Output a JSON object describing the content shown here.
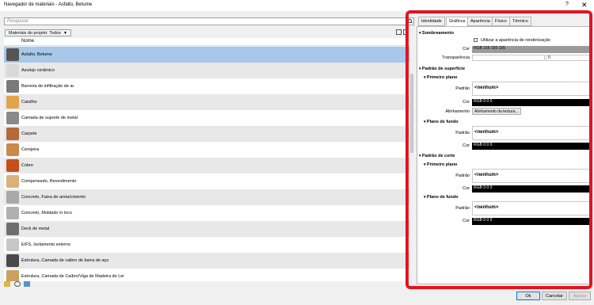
{
  "window": {
    "title": "Navegador de materiais - Asfalto, Betume",
    "help": "?",
    "close": "✕"
  },
  "search": {
    "placeholder": "Pesquisar"
  },
  "filter": {
    "label": "Materiais do projeto: Todos"
  },
  "list": {
    "column": "Nome",
    "items": [
      {
        "label": "Asfalto, Betume",
        "color": "#555555",
        "selected": true
      },
      {
        "label": "Azulejo cerâmico",
        "color": "#d9d9d9"
      },
      {
        "label": "Barreira de infiltração de ar",
        "color": "#7a7a7a"
      },
      {
        "label": "Caixilho",
        "color": "#e3a24c"
      },
      {
        "label": "Camada de suporte de metal",
        "color": "#8a8a8a"
      },
      {
        "label": "Carpete",
        "color": "#b46a3a"
      },
      {
        "label": "Cerejeira",
        "color": "#c98a4a"
      },
      {
        "label": "Cobre",
        "color": "#c4501a"
      },
      {
        "label": "Compensado, Revestimento",
        "color": "#d9b27a"
      },
      {
        "label": "Concreto, Faixa de areia/cimento",
        "color": "#a8a8a8"
      },
      {
        "label": "Concreto, Moldado in loco",
        "color": "#b0b0b0"
      },
      {
        "label": "Deck de metal",
        "color": "#6e6e6e"
      },
      {
        "label": "EIFS, Isolamento externo",
        "color": "#c7c7c7"
      },
      {
        "label": "Estrutura, Camada de caibro de barra de aço",
        "color": "#4a4a4a"
      },
      {
        "label": "Estrutura, Camada de Caibro/Viga de Madeira de Lei",
        "color": "#c9a15e"
      }
    ]
  },
  "tabs": [
    "Identidade",
    "Gráficos",
    "Aparência",
    "Físico",
    "Térmico"
  ],
  "props": {
    "shading": {
      "title": "Sombreamento",
      "render_appearance": "Utilizar a aparência de renderização",
      "color_label": "Cor",
      "color_value": "RGB 155 155 155",
      "transparency_label": "Transparência",
      "transparency_value": "0"
    },
    "surface": {
      "title": "Padrão de superfície",
      "fg": {
        "title": "Primeiro plano",
        "pattern_label": "Padrão",
        "pattern_value": "<nenhum>",
        "color_label": "Cor",
        "color_value": "RGB 0 0 0",
        "align_label": "Alinhamento",
        "align_button": "Alinhamento da textura..."
      },
      "bg": {
        "title": "Plano de fundo",
        "pattern_label": "Padrão",
        "pattern_value": "<nenhum>",
        "color_label": "Cor",
        "color_value": "RGB 0 0 0"
      }
    },
    "cut": {
      "title": "Padrão de corte",
      "fg": {
        "title": "Primeiro plano",
        "pattern_label": "Padrão",
        "pattern_value": "<nenhum>",
        "color_label": "Cor",
        "color_value": "RGB 0 0 0"
      },
      "bg": {
        "title": "Plano de fundo",
        "pattern_label": "Padrão",
        "pattern_value": "<nenhum>",
        "color_label": "Cor",
        "color_value": "RGB 0 0 0"
      }
    }
  },
  "footer": {
    "ok": "Ok",
    "cancel": "Cancelar",
    "apply": "Aplicar"
  },
  "colors": {
    "highlight": "#e3141f",
    "selected_row": "#a9c7e8"
  }
}
